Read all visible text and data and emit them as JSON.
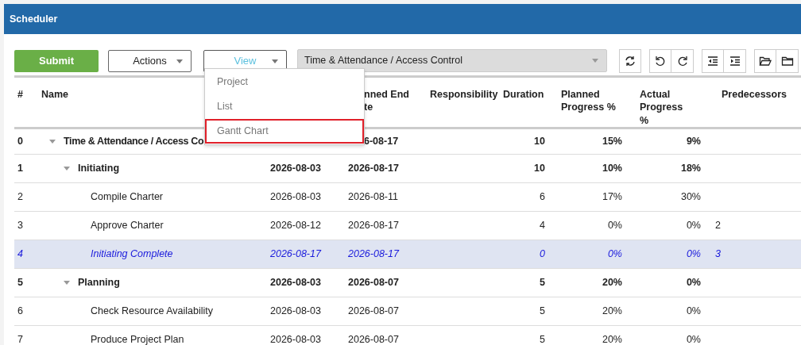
{
  "window": {
    "title": "Scheduler"
  },
  "toolbar": {
    "buttons": [
      {
        "kind": "submit",
        "label": "Submit"
      },
      {
        "kind": "dropdown",
        "label": "Actions",
        "expanded": false
      },
      {
        "kind": "dropdown",
        "label": "View",
        "expanded": true
      }
    ],
    "project_select": {
      "value": "Time & Attendance / Access Control"
    }
  },
  "view_menu": {
    "items": [
      {
        "label": "Project",
        "selected": false
      },
      {
        "label": "List",
        "selected": false
      },
      {
        "label": "Gantt Chart",
        "selected": true
      }
    ]
  },
  "table": {
    "columns": [
      "#",
      "Name",
      "nned End\nte",
      "Responsibility",
      "Duration",
      "Planned\nProgress %",
      "Actual Progress\n%",
      "Predecessors"
    ],
    "rows": [
      {
        "num": "0",
        "name": "Time & Attendance / Access Co",
        "end": "6-08-17",
        "duration": "10",
        "planned": "15%",
        "actual": "9%",
        "kind": "summary",
        "expanded": true,
        "selected": false,
        "children": [
          {
            "num": "1",
            "name": "Initiating",
            "start": "2026-08-03",
            "end": "2026-08-17",
            "duration": "10",
            "planned": "10%",
            "actual": "18%",
            "kind": "summary",
            "expanded": true,
            "selected": false,
            "children": [
              {
                "num": "2",
                "name": "Compile Charter",
                "start": "2026-08-03",
                "end": "2026-08-11",
                "duration": "6",
                "planned": "17%",
                "actual": "30%",
                "kind": "task",
                "selected": false
              },
              {
                "num": "3",
                "name": "Approve Charter",
                "start": "2026-08-12",
                "end": "2026-08-17",
                "duration": "4",
                "planned": "0%",
                "actual": "0%",
                "predecessors": "2",
                "kind": "task",
                "selected": false
              },
              {
                "num": "4",
                "name": "Initiating Complete",
                "start": "2026-08-17",
                "end": "2026-08-17",
                "duration": "0",
                "planned": "0%",
                "actual": "0%",
                "predecessors": "3",
                "kind": "milestone",
                "selected": true
              }
            ]
          },
          {
            "num": "5",
            "name": "Planning",
            "start": "2026-08-03",
            "end": "2026-08-07",
            "duration": "5",
            "planned": "20%",
            "actual": "0%",
            "kind": "summary",
            "expanded": true,
            "selected": false,
            "children": [
              {
                "num": "6",
                "name": "Check Resource Availability",
                "start": "2026-08-03",
                "end": "2026-08-07",
                "duration": "5",
                "planned": "20%",
                "actual": "0%",
                "kind": "task",
                "selected": false
              },
              {
                "num": "7",
                "name": "Produce Project Plan",
                "start": "2026-08-03",
                "end": "2026-08-07",
                "duration": "5",
                "planned": "20%",
                "actual": "0%",
                "kind": "task",
                "selected": false
              }
            ]
          }
        ]
      }
    ]
  }
}
